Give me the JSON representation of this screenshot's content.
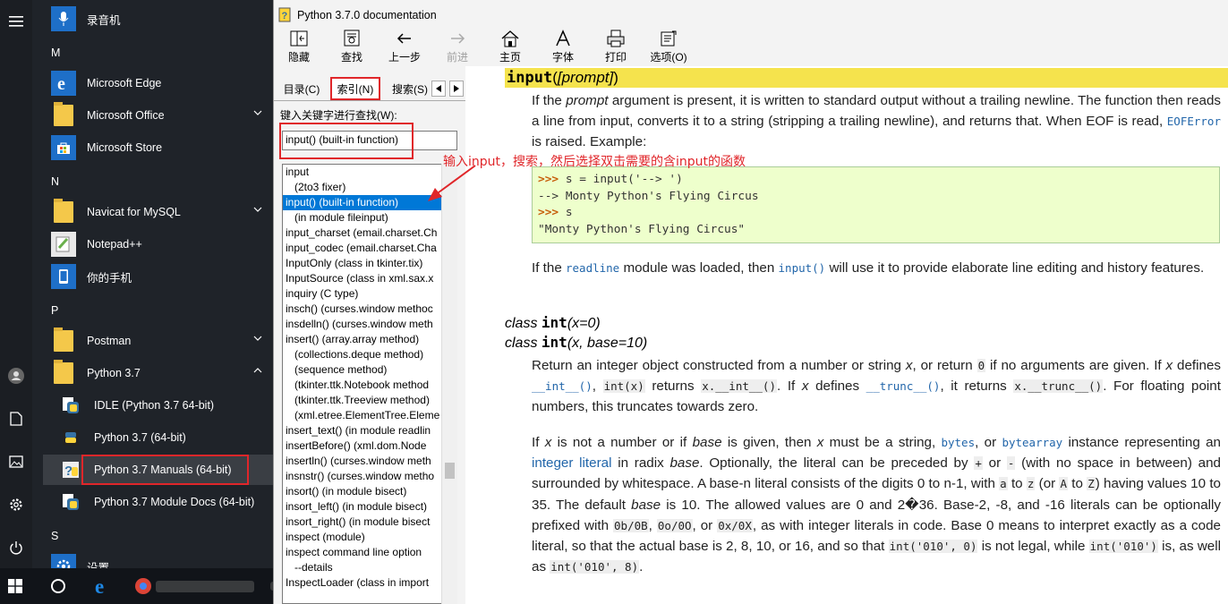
{
  "start_menu": {
    "top_item": "录音机",
    "sections": [
      {
        "letter": "M",
        "items": [
          "Microsoft Edge",
          "Microsoft Office",
          "Microsoft Store"
        ]
      },
      {
        "letter": "N",
        "items": [
          "Navicat for MySQL",
          "Notepad++",
          "你的手机"
        ]
      },
      {
        "letter": "P",
        "items": [
          "Postman",
          "Python 3.7"
        ]
      },
      {
        "letter": "S",
        "items": [
          "设置"
        ]
      }
    ],
    "python_subitems": [
      "IDLE (Python 3.7 64-bit)",
      "Python 3.7 (64-bit)",
      "Python 3.7 Manuals (64-bit)",
      "Python 3.7 Module Docs (64-bit)"
    ],
    "rail_icons": [
      "hamburger-icon",
      "user-icon",
      "document-icon",
      "pictures-icon",
      "settings-icon",
      "power-icon"
    ]
  },
  "help": {
    "title": "Python 3.7.0 documentation",
    "toolbar": [
      {
        "label": "隐藏",
        "icon": "hide-icon",
        "enabled": true
      },
      {
        "label": "查找",
        "icon": "find-icon",
        "enabled": true
      },
      {
        "label": "上一步",
        "icon": "back-icon",
        "enabled": true
      },
      {
        "label": "前进",
        "icon": "forward-icon",
        "enabled": false
      },
      {
        "label": "主页",
        "icon": "home-icon",
        "enabled": true
      },
      {
        "label": "字体",
        "icon": "font-icon",
        "enabled": true
      },
      {
        "label": "打印",
        "icon": "print-icon",
        "enabled": true
      },
      {
        "label": "选项(O)",
        "icon": "options-icon",
        "enabled": true
      }
    ],
    "tabs": [
      "目录(C)",
      "索引(N)",
      "搜索(S)"
    ],
    "active_tab": "索引(N)",
    "keyword_label": "键入关键字进行查找(W):",
    "keyword_value": "input() (built-in function)",
    "index_items": [
      {
        "text": "input",
        "indent": false
      },
      {
        "text": "(2to3 fixer)",
        "indent": true
      },
      {
        "text": "input() (built-in function)",
        "indent": false,
        "selected": true
      },
      {
        "text": "(in module fileinput)",
        "indent": true
      },
      {
        "text": "input_charset (email.charset.Ch",
        "indent": false
      },
      {
        "text": "input_codec (email.charset.Cha",
        "indent": false
      },
      {
        "text": "InputOnly (class in tkinter.tix)",
        "indent": false
      },
      {
        "text": "InputSource (class in xml.sax.x",
        "indent": false
      },
      {
        "text": "inquiry (C type)",
        "indent": false
      },
      {
        "text": "insch() (curses.window methoc",
        "indent": false
      },
      {
        "text": "insdelln() (curses.window meth",
        "indent": false
      },
      {
        "text": "insert() (array.array method)",
        "indent": false
      },
      {
        "text": "(collections.deque method)",
        "indent": true
      },
      {
        "text": "(sequence method)",
        "indent": true
      },
      {
        "text": "(tkinter.ttk.Notebook method",
        "indent": true
      },
      {
        "text": "(tkinter.ttk.Treeview method)",
        "indent": true
      },
      {
        "text": "(xml.etree.ElementTree.Eleme",
        "indent": true
      },
      {
        "text": "insert_text() (in module readlin",
        "indent": false
      },
      {
        "text": "insertBefore() (xml.dom.Node",
        "indent": false
      },
      {
        "text": "insertln() (curses.window meth",
        "indent": false
      },
      {
        "text": "insnstr() (curses.window metho",
        "indent": false
      },
      {
        "text": "insort() (in module bisect)",
        "indent": false
      },
      {
        "text": "insort_left() (in module bisect)",
        "indent": false
      },
      {
        "text": "insort_right() (in module bisect",
        "indent": false
      },
      {
        "text": "inspect (module)",
        "indent": false
      },
      {
        "text": "inspect command line option",
        "indent": false
      },
      {
        "text": "--details",
        "indent": true
      },
      {
        "text": "InspectLoader (class in import",
        "indent": false
      }
    ],
    "annotation": "输入input，搜索，然后选择双击需要的含input的函数"
  },
  "doc": {
    "sig1": {
      "name": "input",
      "open": "(",
      "param": "[prompt]",
      "close": ")"
    },
    "p1": {
      "t1": "If the ",
      "em1": "prompt",
      "t2": " argument is present, it is written to standard output without a trailing newline. The function then reads a line from input, converts it to a string (stripping a trailing newline), and returns that. When EOF is read, ",
      "code1": "EOFError",
      "t3": " is raised. Example:"
    },
    "code_lines": [
      {
        "prompt": ">>>",
        "text": " s = input('--> ')"
      },
      {
        "prompt": "",
        "text": "--> Monty Python's Flying Circus"
      },
      {
        "prompt": ">>>",
        "text": " s"
      },
      {
        "prompt": "",
        "text": "\"Monty Python's Flying Circus\""
      }
    ],
    "p2": {
      "t1": "If the ",
      "link1": "readline",
      "t2": " module was loaded, then ",
      "link2": "input()",
      "t3": " will use it to provide elaborate line editing and history features."
    },
    "sig2": {
      "kw": "class",
      "name": "int",
      "params": "(x=0)"
    },
    "sig3": {
      "kw": "class",
      "name": "int",
      "params": "(x, base=10)"
    },
    "p3": {
      "t1": "Return an integer object constructed from a number or string ",
      "em1": "x",
      "t2": ", or return ",
      "c1": "0",
      "t3": " if no arguments are given. If ",
      "em2": "x",
      "t4": " defines ",
      "l1": "__int__()",
      "t5": ", ",
      "c2": "int(x)",
      "t6": " returns ",
      "c3": "x.__int__()",
      "t7": ". If ",
      "em3": "x",
      "t8": " defines ",
      "l2": "__trunc__()",
      "t9": ", it returns ",
      "c4": "x.__trunc__()",
      "t10": ". For floating point numbers, this truncates towards zero."
    },
    "p4": {
      "t1": "If ",
      "em1": "x",
      "t2": " is not a number or if ",
      "em2": "base",
      "t3": " is given, then ",
      "em3": "x",
      "t4": " must be a string, ",
      "l1": "bytes",
      "t5": ", or ",
      "l2": "bytearray",
      "t6": " instance representing an ",
      "l3": "integer literal",
      "t7": " in radix ",
      "em4": "base",
      "t8": ". Optionally, the literal can be preceded by ",
      "c1": "+",
      "t9": " or ",
      "c2": "-",
      "t10": " (with no space in between) and surrounded by whitespace. A base-n literal consists of the digits 0 to n-1, with ",
      "c3": "a",
      "t11": " to ",
      "c4": "z",
      "t12": " (or ",
      "c5": "A",
      "t13": " to ",
      "c6": "Z",
      "t14": ") having values 10 to 35. The default ",
      "em5": "base",
      "t15": " is 10. The allowed values are 0 and 2�36. Base-2, -8, and -16 literals can be optionally prefixed with ",
      "c7": "0b/0B",
      "t16": ", ",
      "c8": "0o/0O",
      "t17": ", or ",
      "c9": "0x/0X",
      "t18": ", as with integer literals in code. Base 0 means to interpret exactly as a code literal, so that the actual base is 2, 8, 10, or 16, and so that ",
      "c10": "int('010', 0)",
      "t19": " is not legal, while ",
      "c11": "int('010')",
      "t20": " is, as well as ",
      "c12": "int('010', 8)",
      "t21": "."
    }
  },
  "colors": {
    "highlight_sig": "#f5e34d",
    "annotation": "#e0262a",
    "selected": "#0078d7",
    "code_bg": "#eeffcc"
  }
}
